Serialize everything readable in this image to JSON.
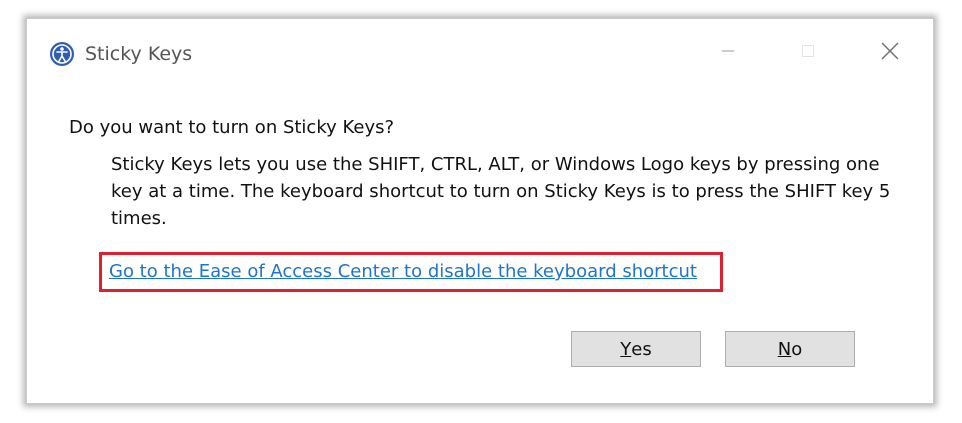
{
  "window": {
    "title": "Sticky Keys",
    "icon": "ease-of-access-icon",
    "controls": [
      "minimize-icon",
      "maximize-icon",
      "close-icon"
    ]
  },
  "dialog": {
    "question": "Do you want to turn on Sticky Keys?",
    "description": "Sticky Keys lets you use the SHIFT, CTRL, ALT, or Windows Logo keys by pressing one key at a time. The keyboard shortcut to turn on Sticky Keys is to press the SHIFT key 5 times.",
    "link": "Go to the Ease of Access Center to disable the keyboard shortcut"
  },
  "buttons": {
    "yes": {
      "access_key": "Y",
      "rest": "es"
    },
    "no": {
      "access_key": "N",
      "rest": "o"
    }
  },
  "colors": {
    "link": "#1e74d0",
    "highlight": "#e0202e",
    "icon_blue": "#2f5cb5"
  }
}
